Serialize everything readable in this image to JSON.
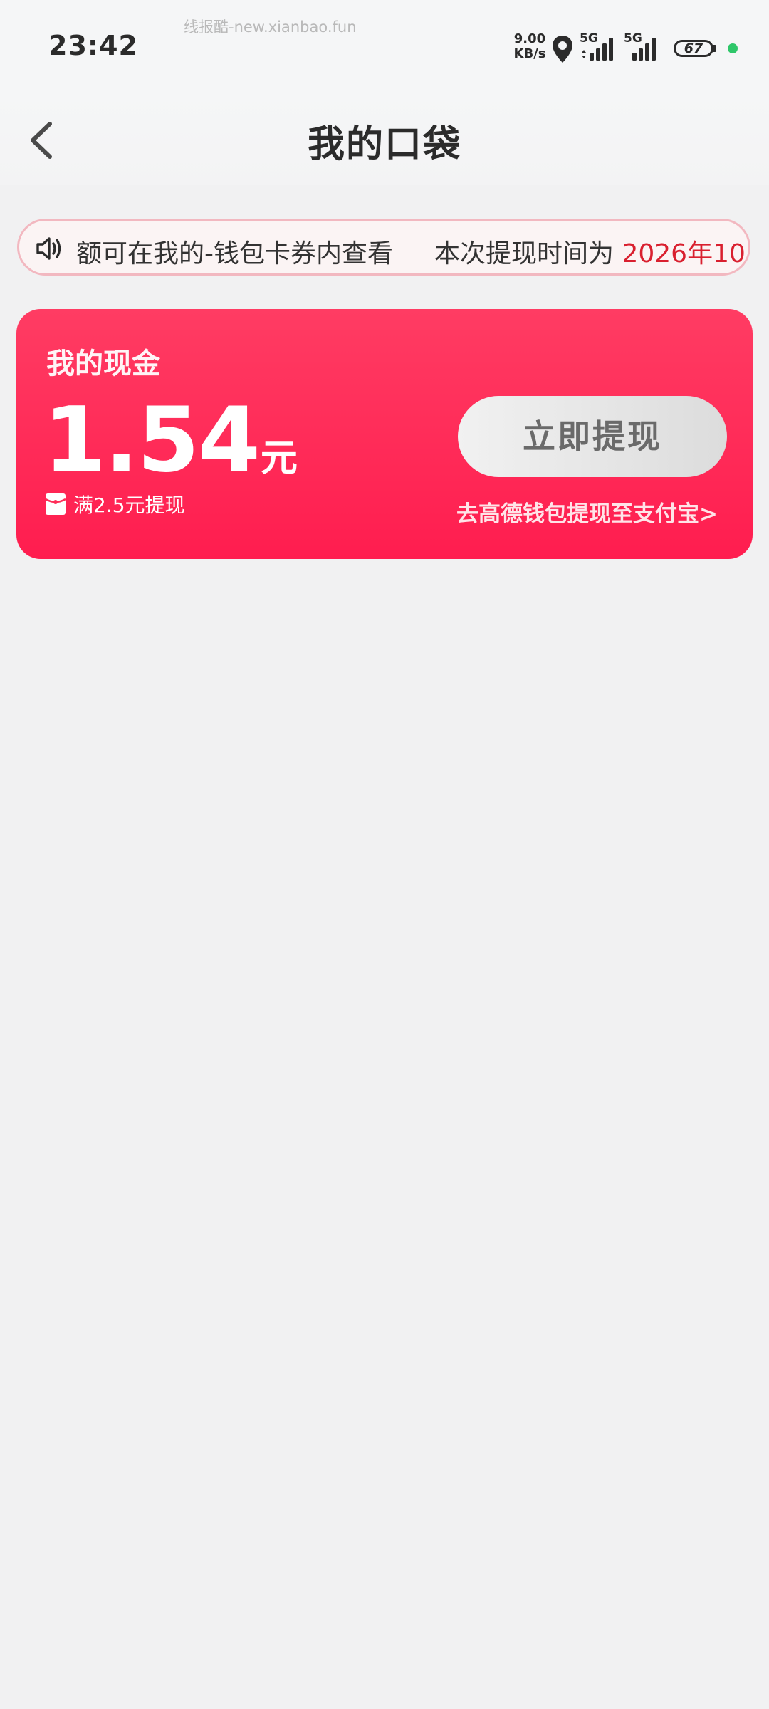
{
  "status_bar": {
    "time": "23:42",
    "watermark": "线报酷-new.xianbao.fun",
    "net_speed_value": "9.00",
    "net_speed_unit": "KB/s",
    "sim1_label": "5G",
    "sim2_label": "5G",
    "battery_level": "67",
    "colors": {
      "active_dot": "#2fc76a"
    }
  },
  "nav": {
    "title": "我的口袋"
  },
  "notice": {
    "text_part1": "额可在我的-钱包卡券内查看",
    "text_part2": "本次提现时间为",
    "text_date": "2026年10"
  },
  "cash_card": {
    "title": "我的现金",
    "amount": "1.54",
    "unit": "元",
    "threshold_text": "满2.5元提现",
    "withdraw_button_label": "立即提现",
    "alipay_link_text": "去高德钱包提现至支付宝>",
    "colors": {
      "card_top": "#ff3c63",
      "card_bottom": "#ff1d4f"
    }
  }
}
